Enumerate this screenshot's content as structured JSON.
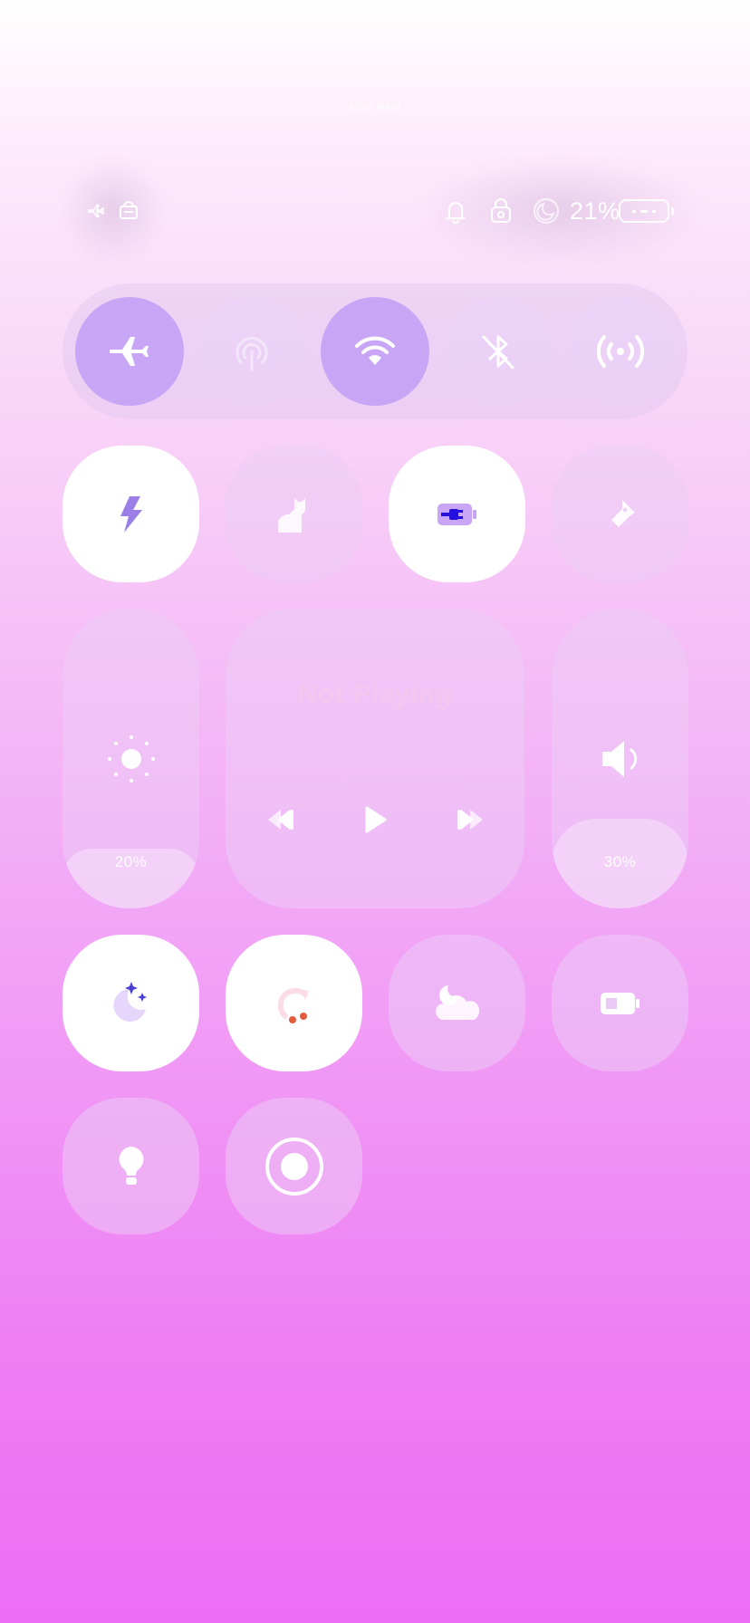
{
  "status_bar": {
    "carrier_text": "ADD NAM",
    "left_icons": [
      "airplane-mode-icon",
      "hotspot-phone-icon"
    ],
    "right_icons": [
      "bell-icon",
      "rotation-lock-icon",
      "do-not-disturb-moon-icon"
    ],
    "battery_percent": "21%",
    "battery_level": 0.21
  },
  "connectivity": {
    "buttons": [
      {
        "name": "airplane-mode",
        "icon": "airplane-icon",
        "active": true
      },
      {
        "name": "mobile-data",
        "icon": "cellular-antenna-icon",
        "active": false
      },
      {
        "name": "wifi",
        "icon": "wifi-icon",
        "active": true
      },
      {
        "name": "bluetooth",
        "icon": "bluetooth-off-icon",
        "active": false
      },
      {
        "name": "hotspot",
        "icon": "broadcast-icon",
        "active": false
      }
    ]
  },
  "quick_tiles_row1": [
    {
      "name": "power-saving",
      "icon": "lightning-icon",
      "active": true
    },
    {
      "name": "cat-mode",
      "icon": "cat-icon",
      "active": false
    },
    {
      "name": "battery-charge",
      "icon": "battery-plug-icon",
      "active": true
    },
    {
      "name": "flashlight",
      "icon": "flashlight-icon",
      "active": false
    }
  ],
  "brightness": {
    "label": "20%",
    "level": 0.2
  },
  "media": {
    "title": "Not Playing",
    "controls": [
      "previous",
      "play",
      "next"
    ]
  },
  "volume": {
    "label": "30%",
    "level": 0.3
  },
  "quick_tiles_row2": [
    {
      "name": "dark-mode",
      "icon": "moon-stars-icon",
      "active": true
    },
    {
      "name": "auto-rotate",
      "icon": "rotate-icon",
      "active": true
    },
    {
      "name": "night-light",
      "icon": "moon-cloud-icon",
      "active": false
    },
    {
      "name": "battery-saver",
      "icon": "battery-low-icon",
      "active": false
    }
  ],
  "quick_tiles_row3": [
    {
      "name": "bulb",
      "icon": "lightbulb-icon",
      "active": false
    },
    {
      "name": "screen-record",
      "icon": "record-icon",
      "active": false
    }
  ],
  "colors": {
    "accent_active": "#c9a6f5",
    "bolt": "#9b7ee8",
    "battery_plug": "#2211dd",
    "stars": "#4a3fd6",
    "rotate_dots": "#e25b3a"
  }
}
